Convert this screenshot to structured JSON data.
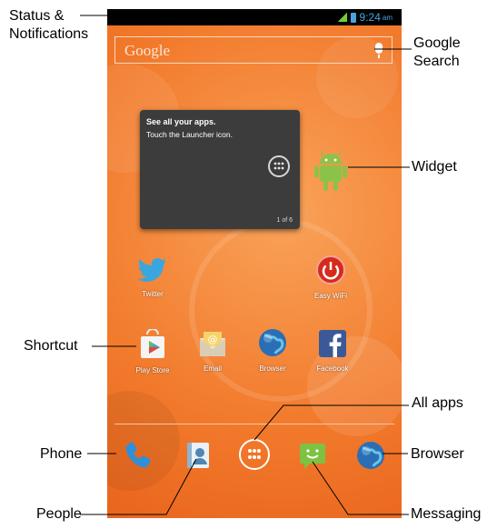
{
  "callouts": {
    "status": "Status &\nNotifications",
    "google_search": "Google\nSearch",
    "widget": "Widget",
    "shortcut": "Shortcut",
    "all_apps": "All apps",
    "phone": "Phone",
    "browser": "Browser",
    "people": "People",
    "messaging": "Messaging"
  },
  "status_bar": {
    "time": "9:24",
    "ampm": "am"
  },
  "search": {
    "brand": "Google"
  },
  "widget": {
    "title": "See all your apps.",
    "text": "Touch the Launcher icon.",
    "page": "1 of 6"
  },
  "home_apps": [
    "Twitter",
    "Easy WiFi",
    "Play Store",
    "Email",
    "Browser",
    "Facebook"
  ],
  "colors": {
    "wallpaper": "#f27a2c",
    "status_bar": "#000000",
    "widget_bg": "#3c3c3c",
    "android_green": "#8bc34a",
    "messaging_green": "#7dc242",
    "phone_blue": "#2f8fd8",
    "globe_blue": "#2a6fb6",
    "twitter_blue": "#3aa6e0",
    "wifi_red": "#d62b1a",
    "facebook_blue": "#3b5998"
  },
  "icons": {
    "mic": "microphone-icon",
    "launcher": "launcher-grid-icon",
    "android": "android-robot-icon",
    "twitter": "twitter-bird-icon",
    "wifi": "power-button-icon",
    "play": "play-store-icon",
    "email": "email-envelope-icon",
    "browser": "globe-icon",
    "facebook": "facebook-f-icon",
    "phone": "phone-handset-icon",
    "people": "contact-card-icon",
    "messaging": "speech-bubble-icon"
  }
}
